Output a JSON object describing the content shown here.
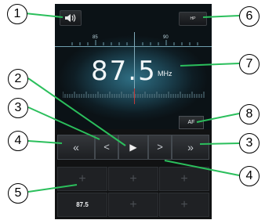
{
  "tuner": {
    "frequency": "87.5",
    "unit": "MHz",
    "scale_labels": [
      "85",
      "90"
    ],
    "hp_label": "HP",
    "af_label": "AF"
  },
  "controls": {
    "rewind": "«",
    "prev": "<",
    "play": "▶",
    "next": ">",
    "fast_forward": "»"
  },
  "presets": [
    "+",
    "+",
    "+",
    "87.5",
    "+",
    "+"
  ],
  "callouts": [
    "1",
    "2",
    "3",
    "3",
    "4",
    "4",
    "5",
    "6",
    "7",
    "8"
  ],
  "colors": {
    "accent_green": "#2bbf5c",
    "panel_teal": "#2f6f84",
    "needle_red": "#c23a3a"
  }
}
